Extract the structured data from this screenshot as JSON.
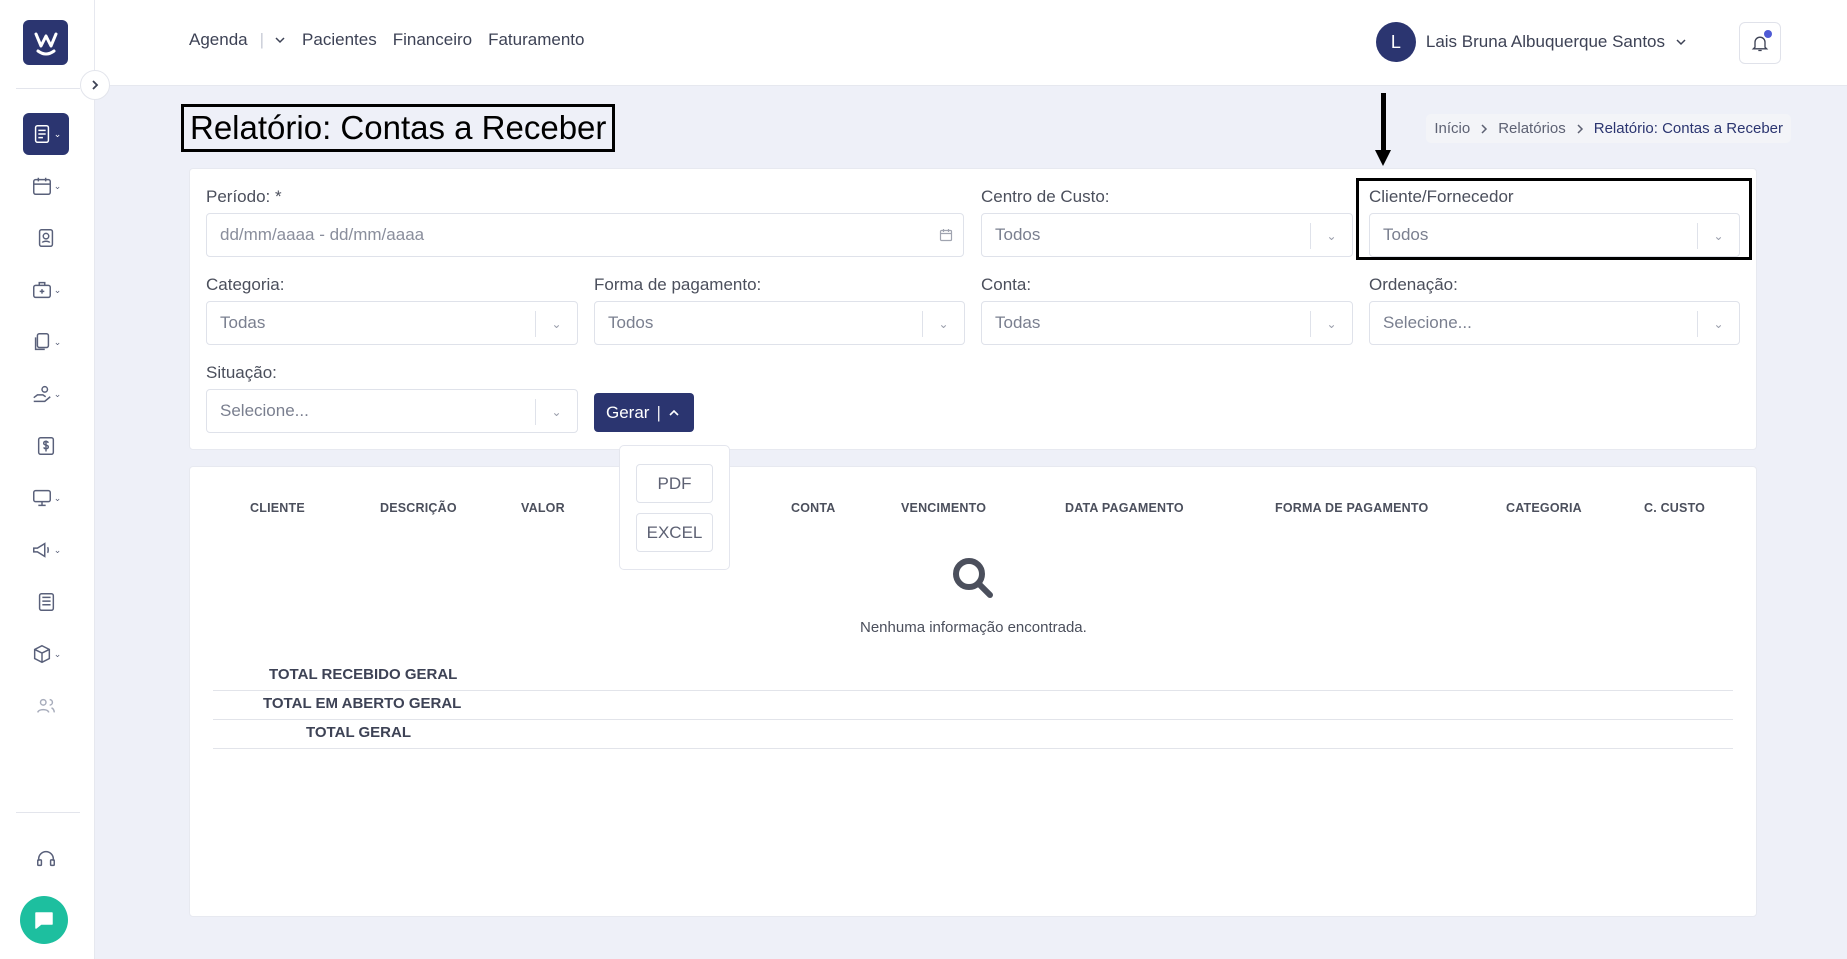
{
  "nav": {
    "agenda": "Agenda",
    "pacientes": "Pacientes",
    "financeiro": "Financeiro",
    "faturamento": "Faturamento"
  },
  "user": {
    "initial": "L",
    "name": "Lais Bruna Albuquerque Santos"
  },
  "page": {
    "title": "Relatório: Contas a Receber"
  },
  "breadcrumb": [
    "Início",
    "Relatórios",
    "Relatório: Contas a Receber"
  ],
  "filters": {
    "periodo": {
      "label": "Período: *",
      "placeholder": "dd/mm/aaaa - dd/mm/aaaa"
    },
    "centro_custo": {
      "label": "Centro de Custo:",
      "value": "Todos"
    },
    "cliente_fornecedor": {
      "label": "Cliente/Fornecedor",
      "value": "Todos"
    },
    "categoria": {
      "label": "Categoria:",
      "value": "Todas"
    },
    "forma_pagamento": {
      "label": "Forma de pagamento:",
      "value": "Todos"
    },
    "conta": {
      "label": "Conta:",
      "value": "Todas"
    },
    "ordenacao": {
      "label": "Ordenação:",
      "value": "Selecione..."
    },
    "situacao": {
      "label": "Situação:",
      "value": "Selecione..."
    }
  },
  "actions": {
    "gerar": "Gerar",
    "pdf": "PDF",
    "excel": "EXCEL"
  },
  "table": {
    "columns": [
      "CLIENTE",
      "DESCRIÇÃO",
      "VALOR",
      "CONTA",
      "VENCIMENTO",
      "DATA PAGAMENTO",
      "FORMA DE PAGAMENTO",
      "CATEGORIA",
      "C. CUSTO"
    ],
    "empty_message": "Nenhuma informação encontrada.",
    "totals": [
      "TOTAL RECEBIDO GERAL",
      "TOTAL EM ABERTO GERAL",
      "TOTAL GERAL"
    ]
  },
  "colors": {
    "primary": "#2b3570",
    "chat": "#1dbf9f",
    "notification_dot": "#4f5bd5"
  },
  "icons": {
    "sidebar": [
      "reports-icon",
      "calendar-icon",
      "patient-badge-icon",
      "medical-bag-icon",
      "documents-icon",
      "hand-money-icon",
      "dollar-icon",
      "monitor-icon",
      "megaphone-icon",
      "newspaper-icon",
      "box-icon",
      "users-icon",
      "headset-icon",
      "chat-icon"
    ]
  }
}
